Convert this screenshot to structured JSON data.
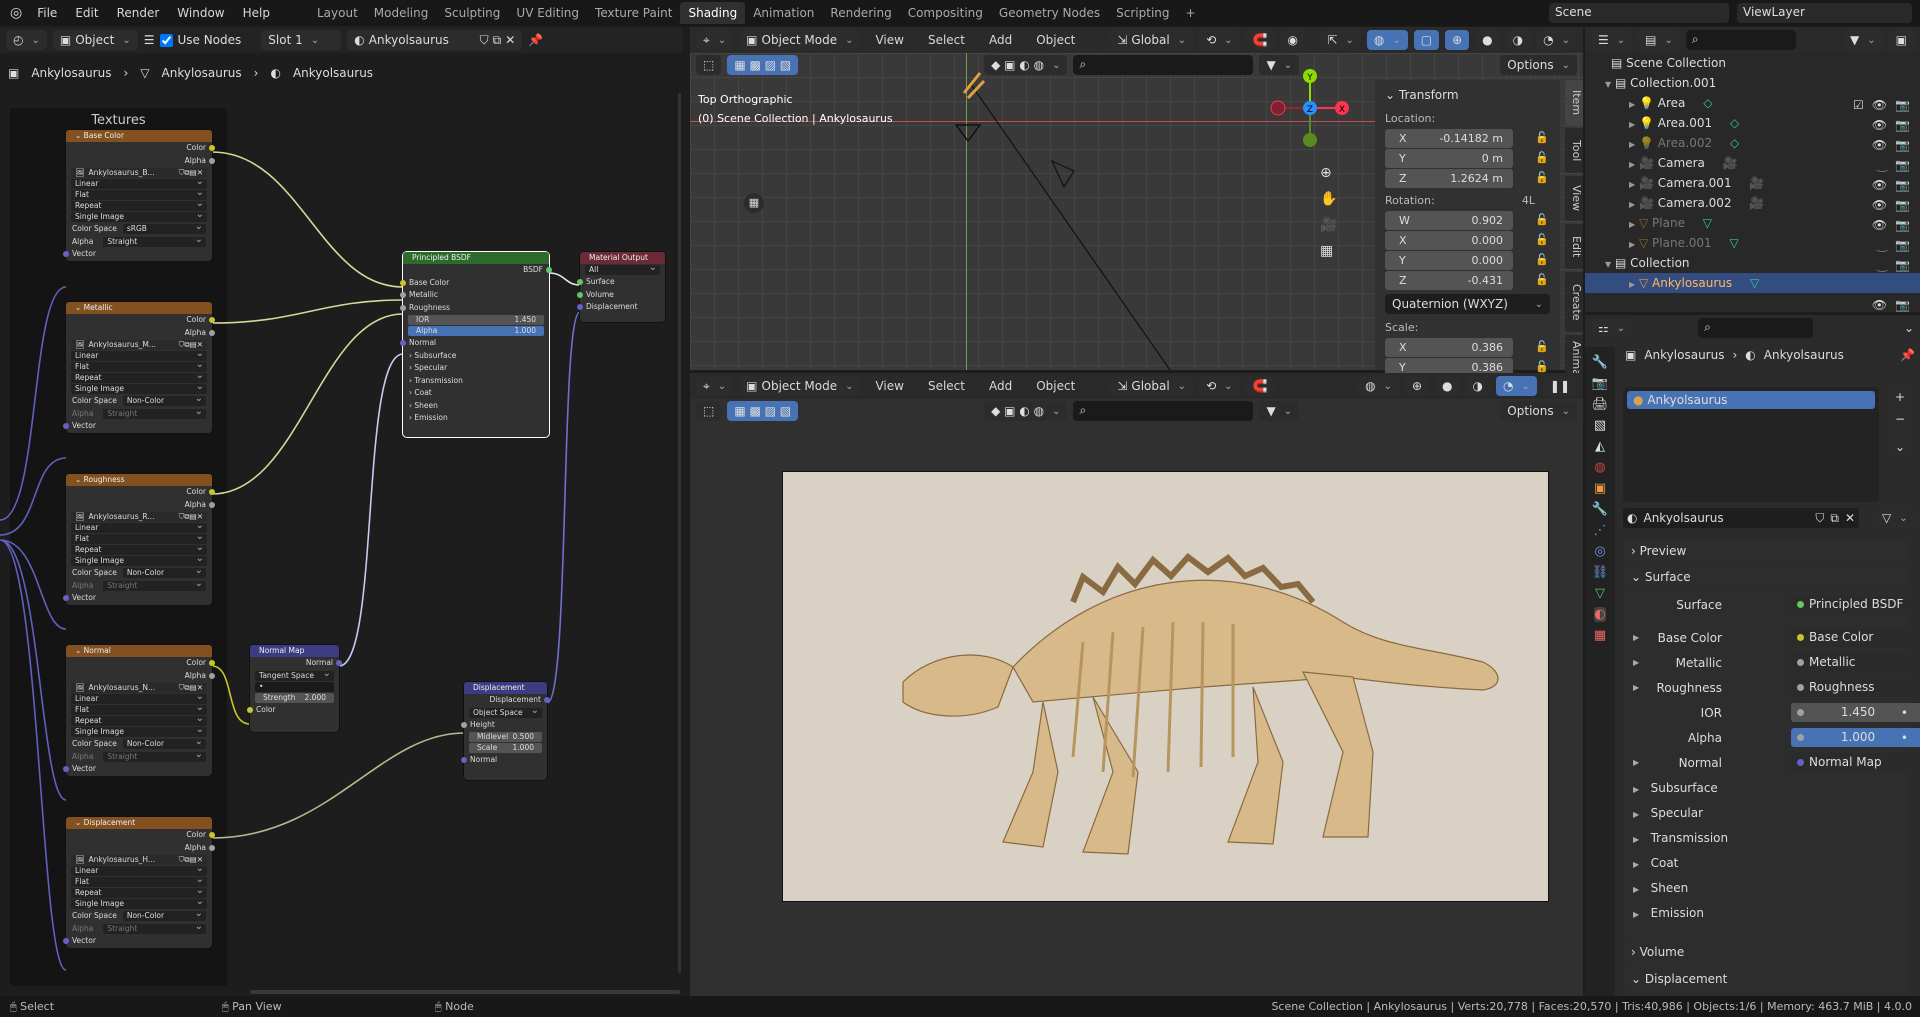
{
  "topbar": {
    "menus": [
      "File",
      "Edit",
      "Render",
      "Window",
      "Help"
    ],
    "workspaces": [
      "Layout",
      "Modeling",
      "Sculpting",
      "UV Editing",
      "Texture Paint",
      "Shading",
      "Animation",
      "Rendering",
      "Compositing",
      "Geometry Nodes",
      "Scripting"
    ],
    "active_workspace": "Shading",
    "scene": "Scene",
    "view_layer": "ViewLayer"
  },
  "node_header": {
    "object_select": "Object",
    "use_nodes_label": "Use Nodes",
    "use_nodes": true,
    "slot": "Slot 1",
    "material": "Ankyolsaurus"
  },
  "breadcrumb": [
    "Ankylosaurus",
    "Ankylosaurus",
    "Ankyolsaurus"
  ],
  "frame_title": "Textures",
  "textures": [
    {
      "title": "Base Color",
      "image": "Ankylosaurus_B...",
      "interp": "Linear",
      "proj": "Flat",
      "ext": "Repeat",
      "src": "Single Image",
      "cs_label": "Color Space",
      "cs": "sRGB",
      "alpha_label": "Alpha",
      "alpha": "Straight",
      "out1": "Color",
      "out2": "Alpha",
      "vec": "Vector"
    },
    {
      "title": "Metallic",
      "image": "Ankylosaurus_M...",
      "interp": "Linear",
      "proj": "Flat",
      "ext": "Repeat",
      "src": "Single Image",
      "cs_label": "Color Space",
      "cs": "Non-Color",
      "alpha_label": "Alpha",
      "alpha": "Straight",
      "out1": "Color",
      "out2": "Alpha",
      "vec": "Vector"
    },
    {
      "title": "Roughness",
      "image": "Ankylosaurus_R...",
      "interp": "Linear",
      "proj": "Flat",
      "ext": "Repeat",
      "src": "Single Image",
      "cs_label": "Color Space",
      "cs": "Non-Color",
      "alpha_label": "Alpha",
      "alpha": "Straight",
      "out1": "Color",
      "out2": "Alpha",
      "vec": "Vector"
    },
    {
      "title": "Normal",
      "image": "Ankylosaurus_N...",
      "interp": "Linear",
      "proj": "Flat",
      "ext": "Repeat",
      "src": "Single Image",
      "cs_label": "Color Space",
      "cs": "Non-Color",
      "alpha_label": "Alpha",
      "alpha": "Straight",
      "out1": "Color",
      "out2": "Alpha",
      "vec": "Vector"
    },
    {
      "title": "Displacement",
      "image": "Ankylosaurus_H...",
      "interp": "Linear",
      "proj": "Flat",
      "ext": "Repeat",
      "src": "Single Image",
      "cs_label": "Color Space",
      "cs": "Non-Color",
      "alpha_label": "Alpha",
      "alpha": "Straight",
      "out1": "Color",
      "out2": "Alpha",
      "vec": "Vector"
    }
  ],
  "bsdf": {
    "title": "Principled BSDF",
    "out": "BSDF",
    "inputs": [
      "Base Color",
      "Metallic",
      "Roughness"
    ],
    "ior_label": "IOR",
    "ior": "1.450",
    "alpha_label": "Alpha",
    "alpha": "1.000",
    "normal": "Normal",
    "panels": [
      "Subsurface",
      "Specular",
      "Transmission",
      "Coat",
      "Sheen",
      "Emission"
    ]
  },
  "matout": {
    "title": "Material Output",
    "target": "All",
    "inputs": [
      "Surface",
      "Volume",
      "Displacement"
    ]
  },
  "normalmap": {
    "title": "Normal Map",
    "out": "Normal",
    "space": "Tangent Space",
    "uv": "•",
    "strength_label": "Strength",
    "strength": "2.000",
    "color": "Color"
  },
  "dispnode": {
    "title": "Displacement",
    "out": "Displacement",
    "space": "Object Space",
    "height": "Height",
    "midlevel_label": "Midlevel",
    "midlevel": "0.500",
    "scale_label": "Scale",
    "scale": "1.000",
    "normal": "Normal"
  },
  "viewport": {
    "mode": "Object Mode",
    "menus": [
      "View",
      "Select",
      "Add",
      "Object"
    ],
    "orientation": "Global",
    "options": "Options",
    "view_name": "Top Orthographic",
    "collection_info": "(0) Scene Collection | Ankylosaurus"
  },
  "transform": {
    "title": "Transform",
    "location_label": "Location:",
    "location": [
      [
        "X",
        "-0.14182 m"
      ],
      [
        "Y",
        "0 m"
      ],
      [
        "Z",
        "1.2624 m"
      ]
    ],
    "rotation_label": "Rotation:",
    "rotation_mode_short": "4L",
    "rotation": [
      [
        "W",
        "0.902"
      ],
      [
        "X",
        "0.000"
      ],
      [
        "Y",
        "0.000"
      ],
      [
        "Z",
        "-0.431"
      ]
    ],
    "rotation_mode": "Quaternion (WXYZ)",
    "scale_label": "Scale:",
    "scale": [
      [
        "X",
        "0.386"
      ],
      [
        "Y",
        "0.386"
      ]
    ]
  },
  "sidebar_tabs": [
    "Item",
    "Tool",
    "View",
    "Edit",
    "Create",
    "Animation"
  ],
  "outliner": {
    "root": "Scene Collection",
    "rows": [
      {
        "name": "Collection.001",
        "type": "collection",
        "indent": 1,
        "dim": false
      },
      {
        "name": "Area",
        "type": "light",
        "indent": 2,
        "dim": false
      },
      {
        "name": "Area.001",
        "type": "light",
        "indent": 2,
        "dim": false
      },
      {
        "name": "Area.002",
        "type": "light",
        "indent": 2,
        "dim": true
      },
      {
        "name": "Camera",
        "type": "camera",
        "indent": 2,
        "dim": false
      },
      {
        "name": "Camera.001",
        "type": "camera",
        "indent": 2,
        "dim": false
      },
      {
        "name": "Camera.002",
        "type": "camera",
        "indent": 2,
        "dim": false
      },
      {
        "name": "Plane",
        "type": "mesh",
        "indent": 2,
        "dim": true
      },
      {
        "name": "Plane.001",
        "type": "mesh",
        "indent": 2,
        "dim": true
      },
      {
        "name": "Collection",
        "type": "collection",
        "indent": 1,
        "dim": false
      },
      {
        "name": "Ankylosaurus",
        "type": "mesh",
        "indent": 2,
        "dim": false,
        "selected": true
      }
    ]
  },
  "properties": {
    "breadcrumb": [
      "Ankylosaurus",
      "Ankyolsaurus"
    ],
    "slot_material": "Ankyolsaurus",
    "material_name": "Ankyolsaurus",
    "preview": "Preview",
    "surface_section": "Surface",
    "surface_label": "Surface",
    "surface_value": "Principled BSDF",
    "rows": [
      {
        "label": "Base Color",
        "value": "Base Color",
        "dot": "#c7c729",
        "expand": true
      },
      {
        "label": "Metallic",
        "value": "Metallic",
        "dot": "#a1a1a1",
        "expand": true
      },
      {
        "label": "Roughness",
        "value": "Roughness",
        "dot": "#a1a1a1",
        "expand": true
      },
      {
        "label": "IOR",
        "value": "1.450",
        "dot": "#a1a1a1",
        "expand": false,
        "numeric": true
      },
      {
        "label": "Alpha",
        "value": "1.000",
        "dot": "#a1a1a1",
        "expand": false,
        "numeric": true,
        "active": true
      },
      {
        "label": "Normal",
        "value": "Normal Map",
        "dot": "#6363c7",
        "expand": true
      }
    ],
    "subpanels": [
      "Subsurface",
      "Specular",
      "Transmission",
      "Coat",
      "Sheen",
      "Emission"
    ],
    "volume": "Volume",
    "displacement": "Displacement"
  },
  "status": {
    "left": "Select",
    "mid": "Pan View",
    "right": "Node",
    "stats": "Scene Collection | Ankylosaurus | Verts:20,778 | Faces:20,570 | Tris:40,986 | Objects:1/6 | Memory: 463.7 MiB | 4.0.0"
  }
}
